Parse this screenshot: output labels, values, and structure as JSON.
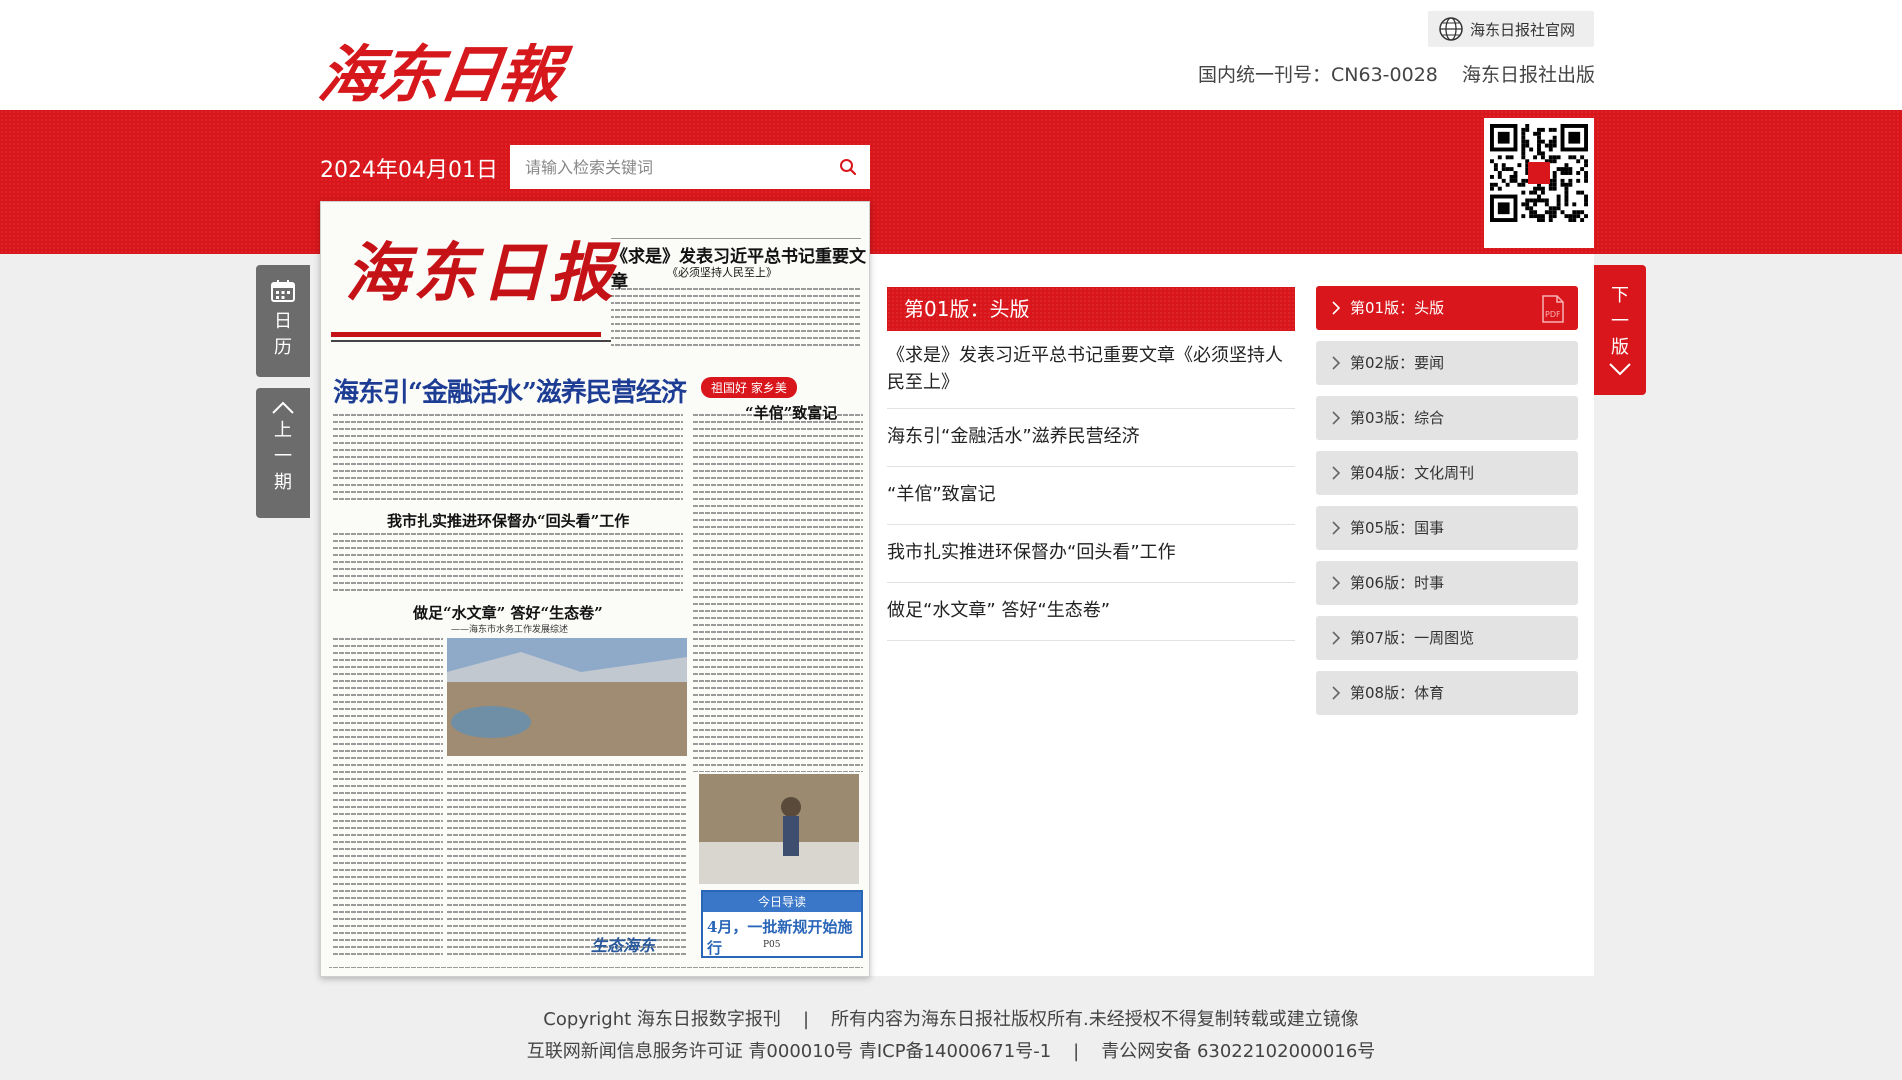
{
  "header": {
    "logo_text": "海东日報",
    "site_link_label": "海东日报社官网",
    "issn_text": "国内统一刊号：CN63-0028",
    "publisher_text": "海东日报社出版"
  },
  "toolbar": {
    "date": "2024年04月01日",
    "search_placeholder": "请输入检索关键词"
  },
  "side": {
    "calendar_label": [
      "日",
      "历"
    ],
    "prev_label": [
      "上",
      "一",
      "期"
    ],
    "next_label": [
      "下",
      "一",
      "版"
    ]
  },
  "current_page": {
    "title": "第01版：头版",
    "articles": [
      "《求是》发表习近平总书记重要文章《必须坚持人民至上》",
      "海东引“金融活水”滋养民营经济",
      "“羊倌”致富记",
      "我市扎实推进环保督办“回头看”工作",
      "做足“水文章” 答好“生态卷”"
    ]
  },
  "pages": [
    {
      "label": "第01版：头版",
      "active": true,
      "pdf": true
    },
    {
      "label": "第02版：要闻",
      "active": false
    },
    {
      "label": "第03版：综合",
      "active": false
    },
    {
      "label": "第04版：文化周刊",
      "active": false
    },
    {
      "label": "第05版：国事",
      "active": false
    },
    {
      "label": "第06版：时事",
      "active": false
    },
    {
      "label": "第07版：一周图览",
      "active": false
    },
    {
      "label": "第08版：体育",
      "active": false
    }
  ],
  "newspaper_thumb": {
    "masthead": "海东日报",
    "top_title": "《求是》发表习近平总书记重要文章",
    "top_subtitle": "《必须坚持人民至上》",
    "headline": "海东引“金融活水”滋养民营经济",
    "headline2": "我市扎实推进环保督办“回头看”工作",
    "headline3": "做足“水文章” 答好“生态卷”",
    "headline3_sub": "——海东市水务工作发展综述",
    "banner": "祖国好 家乡美",
    "side_title": "“羊倌”致富记",
    "guide_title": "今日导读",
    "guide_main": "4月，一批新规开始施行",
    "guide_page": "P05",
    "eco": "生态海东"
  },
  "footer": {
    "line1": [
      "Copyright 海东日报数字报刊",
      "所有内容为海东日报社版权所有.未经授权不得复制转载或建立镜像"
    ],
    "line2": [
      "互联网新闻信息服务许可证 青000010号 青ICP备14000671号-1",
      "青公网安备 63022102000016号"
    ]
  },
  "colors": {
    "brand_red": "#d8161b",
    "side_gray": "#6c6c6c"
  }
}
